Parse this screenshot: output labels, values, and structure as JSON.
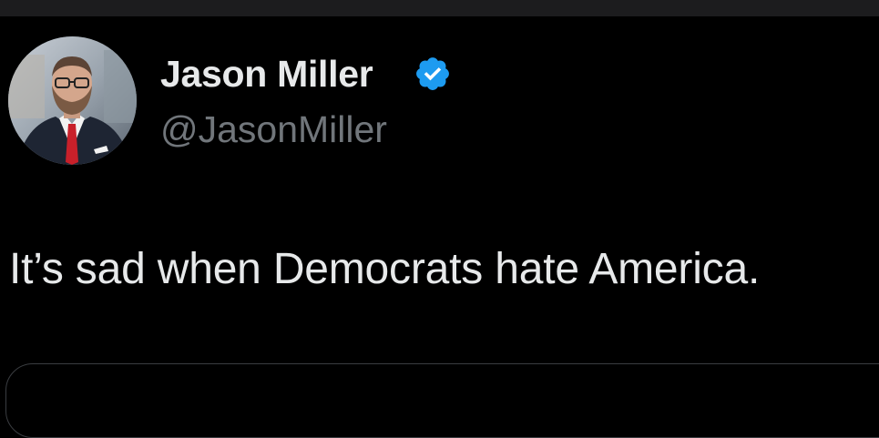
{
  "author": {
    "display_name": "Jason Miller",
    "handle": "@JasonMiller",
    "verified": true,
    "avatar_icon": "profile-photo",
    "verified_icon": "verified-badge-icon"
  },
  "tweet": {
    "text": "It’s sad when Democrats hate America."
  },
  "colors": {
    "background": "#000000",
    "text_primary": "#e7e9ea",
    "text_secondary": "#71767b",
    "verified_blue": "#1d9bf0"
  }
}
